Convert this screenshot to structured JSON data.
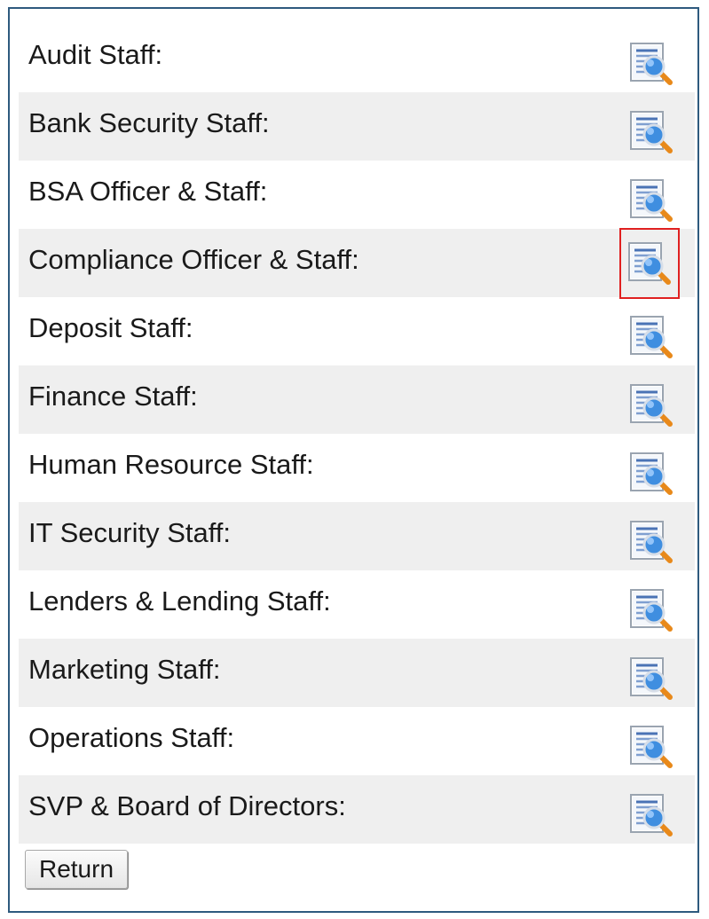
{
  "rows": [
    {
      "label": "Audit Staff:",
      "icon": "view-report-icon"
    },
    {
      "label": "Bank Security Staff:",
      "icon": "view-report-icon"
    },
    {
      "label": "BSA Officer & Staff:",
      "icon": "view-report-icon"
    },
    {
      "label": "Compliance Officer & Staff:",
      "icon": "view-report-icon",
      "highlighted": true
    },
    {
      "label": "Deposit Staff:",
      "icon": "view-report-icon"
    },
    {
      "label": "Finance Staff:",
      "icon": "view-report-icon"
    },
    {
      "label": "Human Resource Staff:",
      "icon": "view-report-icon"
    },
    {
      "label": "IT Security Staff:",
      "icon": "view-report-icon"
    },
    {
      "label": "Lenders & Lending Staff:",
      "icon": "view-report-icon"
    },
    {
      "label": "Marketing Staff:",
      "icon": "view-report-icon"
    },
    {
      "label": "Operations Staff:",
      "icon": "view-report-icon"
    },
    {
      "label": "SVP & Board of Directors:",
      "icon": "view-report-icon"
    }
  ],
  "return_label": "Return",
  "colors": {
    "panel_border": "#2e5a7e",
    "row_alt_background": "#efefef",
    "highlight_border": "#e02020"
  }
}
